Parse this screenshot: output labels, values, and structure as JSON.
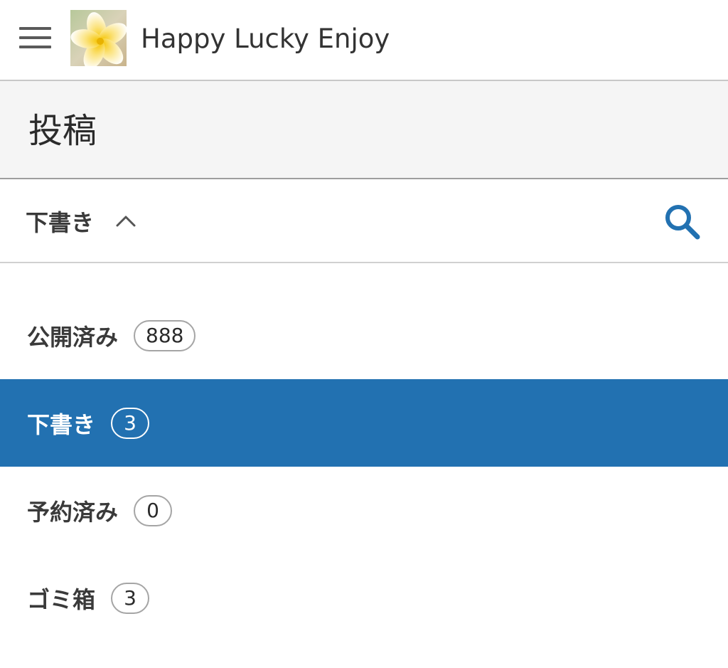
{
  "app": {
    "site_title": "Happy Lucky Enjoy",
    "menu_icon": "hamburger-menu-icon",
    "site_icon": "plumeria-flower-site-icon"
  },
  "page": {
    "title": "投稿"
  },
  "filter": {
    "current_label": "下書き",
    "expanded": true,
    "chevron_icon": "chevron-up-icon",
    "search_icon": "search-icon"
  },
  "statuses": [
    {
      "label": "公開済み",
      "count": "888",
      "selected": false
    },
    {
      "label": "下書き",
      "count": "3",
      "selected": true
    },
    {
      "label": "予約済み",
      "count": "0",
      "selected": false
    },
    {
      "label": "ゴミ箱",
      "count": "3",
      "selected": false
    }
  ],
  "colors": {
    "accent": "#2271b1",
    "text": "#3a3a3a",
    "header_bg": "#f5f5f5"
  }
}
